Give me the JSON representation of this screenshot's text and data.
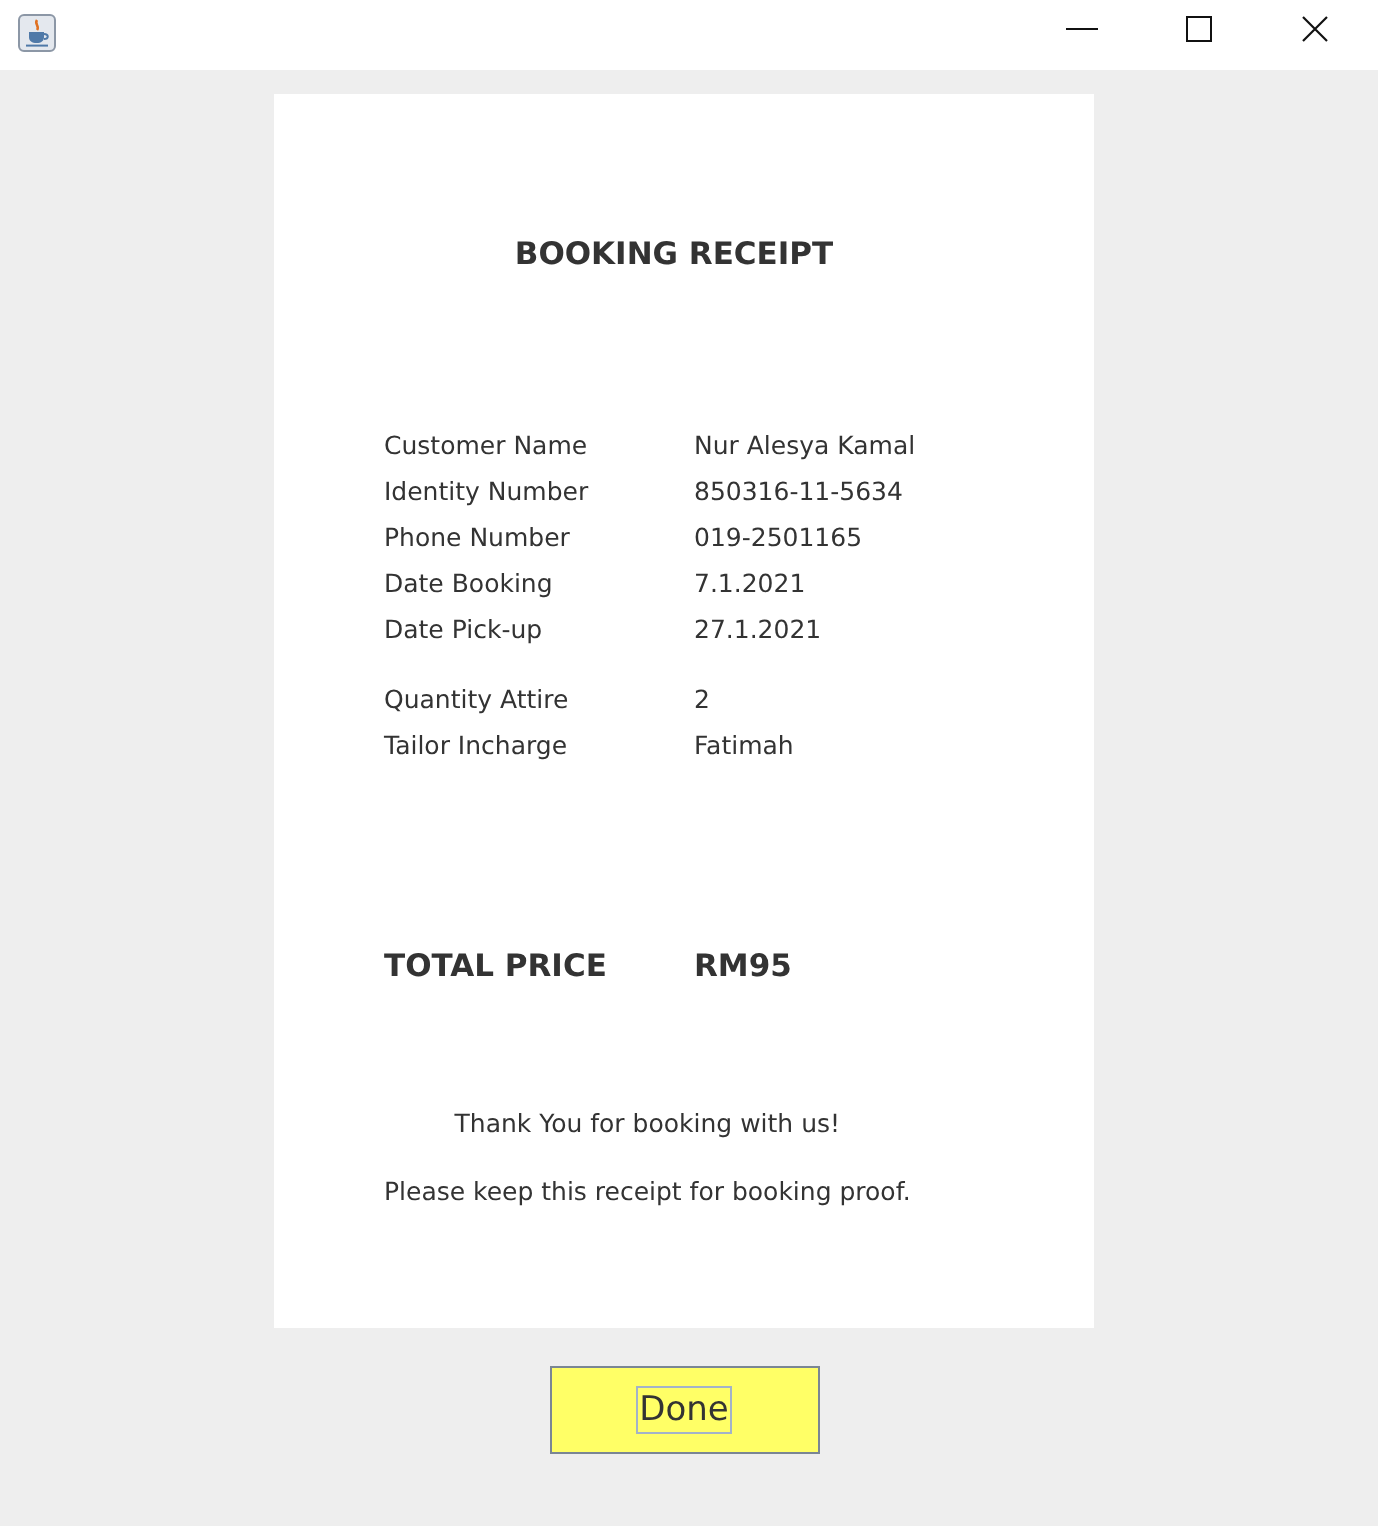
{
  "receipt": {
    "title": "BOOKING RECEIPT",
    "detail_groups": [
      {
        "rows": [
          {
            "label": "Customer Name",
            "value": "Nur Alesya Kamal"
          },
          {
            "label": "Identity Number",
            "value": "850316-11-5634"
          },
          {
            "label": "Phone Number",
            "value": "019-2501165"
          },
          {
            "label": "Date Booking",
            "value": "7.1.2021"
          },
          {
            "label": "Date Pick-up",
            "value": "27.1.2021"
          }
        ]
      },
      {
        "rows": [
          {
            "label": "Quantity Attire",
            "value": "2"
          },
          {
            "label": "Tailor Incharge",
            "value": "Fatimah"
          }
        ]
      }
    ],
    "total": {
      "label": "TOTAL PRICE",
      "value": "RM95"
    },
    "messages": [
      "Thank You for booking with us!",
      "Please keep this receipt for booking proof."
    ]
  },
  "done_button": {
    "label": "Done",
    "focused": true
  }
}
